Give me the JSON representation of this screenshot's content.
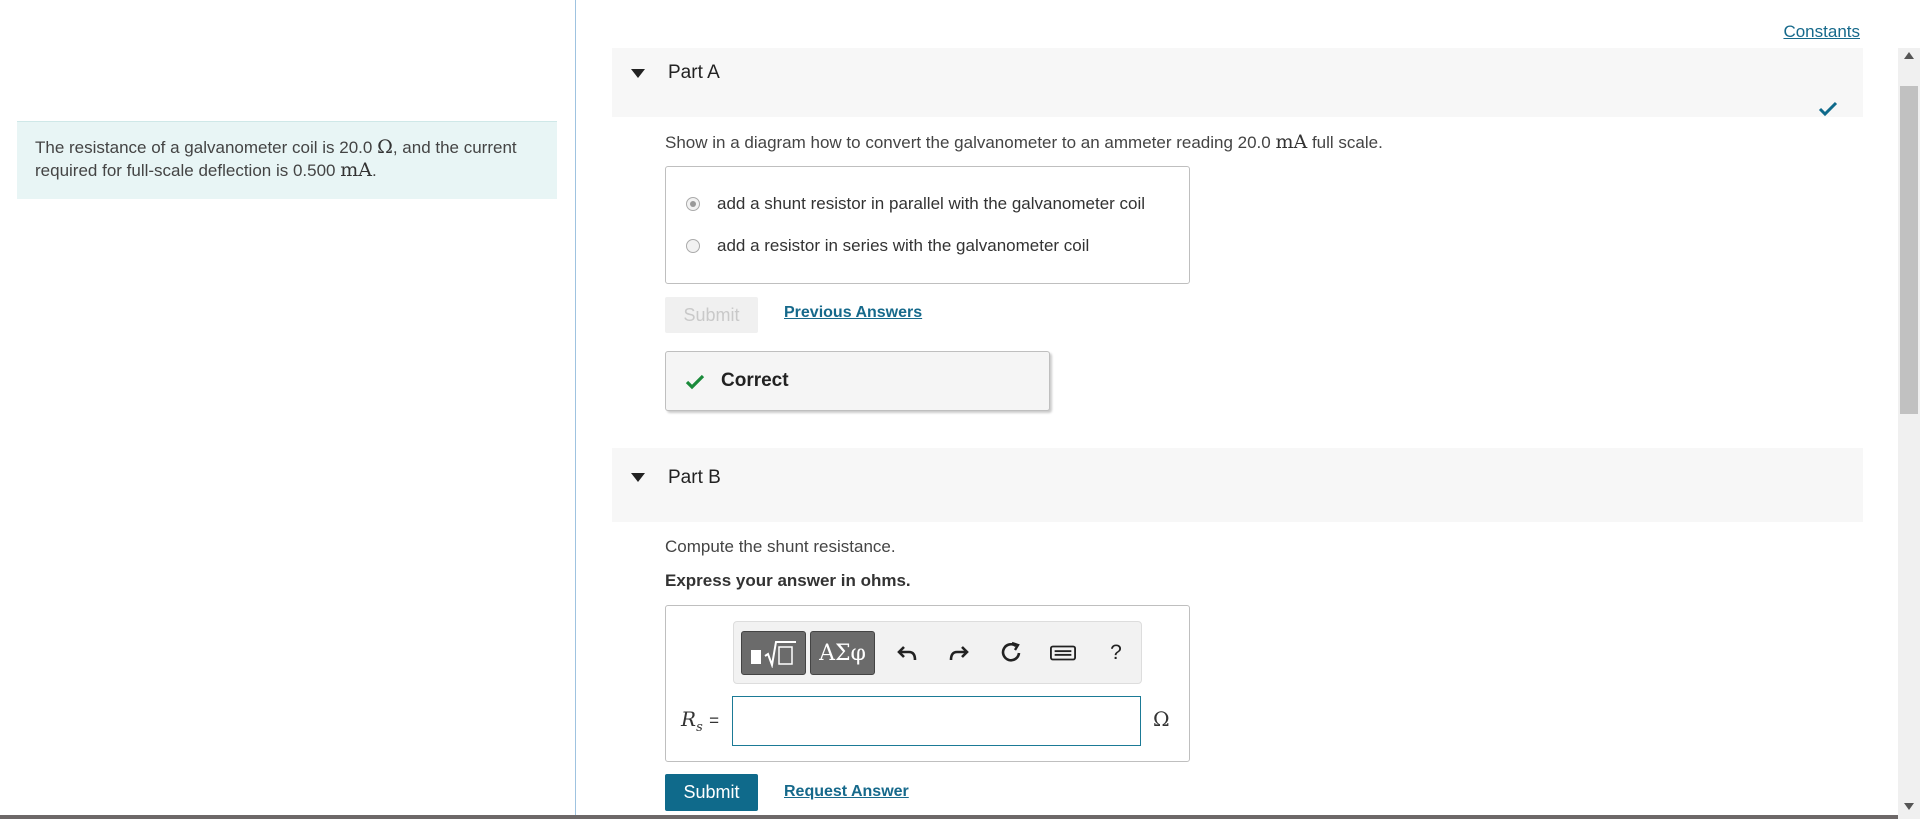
{
  "intro": {
    "text_before_r": "The resistance of a galvanometer coil is 20.0 ",
    "r_unit": "Ω",
    "text_mid": ", and the current required for full-scale deflection is 0.500 ",
    "current_unit": "mA",
    "text_end": "."
  },
  "header": {
    "constants_label": "Constants"
  },
  "part_a": {
    "title": "Part A",
    "question_before": "Show in a diagram how to convert the galvanometer to an ammeter reading 20.0 ",
    "question_unit": "mA",
    "question_after": " full scale.",
    "choices": [
      {
        "label": "add a shunt resistor in parallel with the galvanometer coil",
        "selected": true
      },
      {
        "label": "add a resistor in series with the galvanometer coil",
        "selected": false
      }
    ],
    "submit_label": "Submit",
    "previous_answers_label": "Previous Answers",
    "feedback": "Correct",
    "status_color": "#0f6a8b",
    "correct_color": "#1a8a3a"
  },
  "part_b": {
    "title": "Part B",
    "question": "Compute the shunt resistance.",
    "instruction": "Express your answer in ohms.",
    "toolbar": {
      "templates_icon": "fraction-sqrt-icon",
      "symbols_label": "ΑΣφ",
      "undo_icon": "undo-icon",
      "redo_icon": "redo-icon",
      "reset_icon": "reset-icon",
      "keyboard_icon": "keyboard-icon",
      "help_label": "?"
    },
    "variable_label": "R",
    "variable_subscript": "s",
    "equals": "=",
    "input_value": "",
    "unit": "Ω",
    "submit_label": "Submit",
    "request_answer_label": "Request Answer"
  }
}
